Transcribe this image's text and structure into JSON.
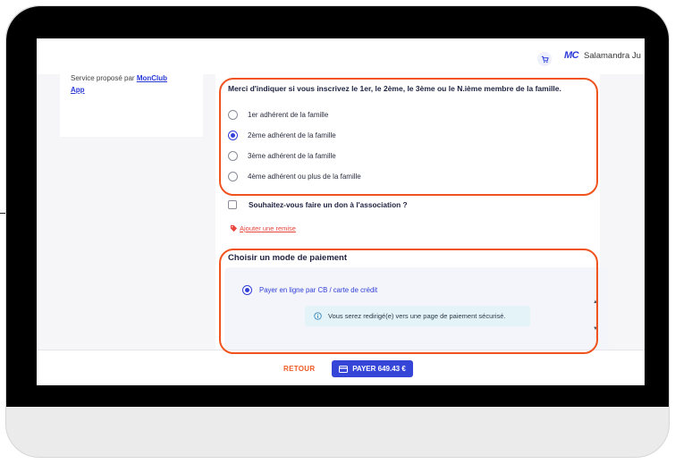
{
  "header": {
    "brand_logo": "MC",
    "user_name": "Salamandra Ju",
    "cart_icon": "cart-icon"
  },
  "sidebar": {
    "service_text": "Service proposé par",
    "service_link_line1": "MonClub",
    "service_link_line2": "App"
  },
  "membership": {
    "question": "Merci d'indiquer si vous inscrivez le 1er, le 2ème, le 3ème ou le N.ième membre de la famille.",
    "options": [
      {
        "label": "1er adhérent de la famille",
        "selected": false
      },
      {
        "label": "2ème adhérent de la famille",
        "selected": true
      },
      {
        "label": "3ème adhérent de la famille",
        "selected": false
      },
      {
        "label": "4ème adhérent ou plus de la famille",
        "selected": false
      }
    ]
  },
  "donation": {
    "label": "Souhaitez-vous faire un don à l'association ?",
    "checked": false
  },
  "discount": {
    "label": "Ajouter une remise",
    "icon": "tag-icon"
  },
  "payment": {
    "title": "Choisir un mode de paiement",
    "option_label": "Payer en ligne par CB / carte de crédit",
    "info_text": "Vous serez redirigé(e) vers une page de paiement sécurisé.",
    "info_icon": "info-icon"
  },
  "footer": {
    "back_label": "RETOUR",
    "pay_label": "PAYER  649.43 €",
    "pay_icon": "card-icon"
  },
  "colors": {
    "accent": "#3545d8",
    "highlight": "#f0531e",
    "danger": "#e9453d"
  }
}
